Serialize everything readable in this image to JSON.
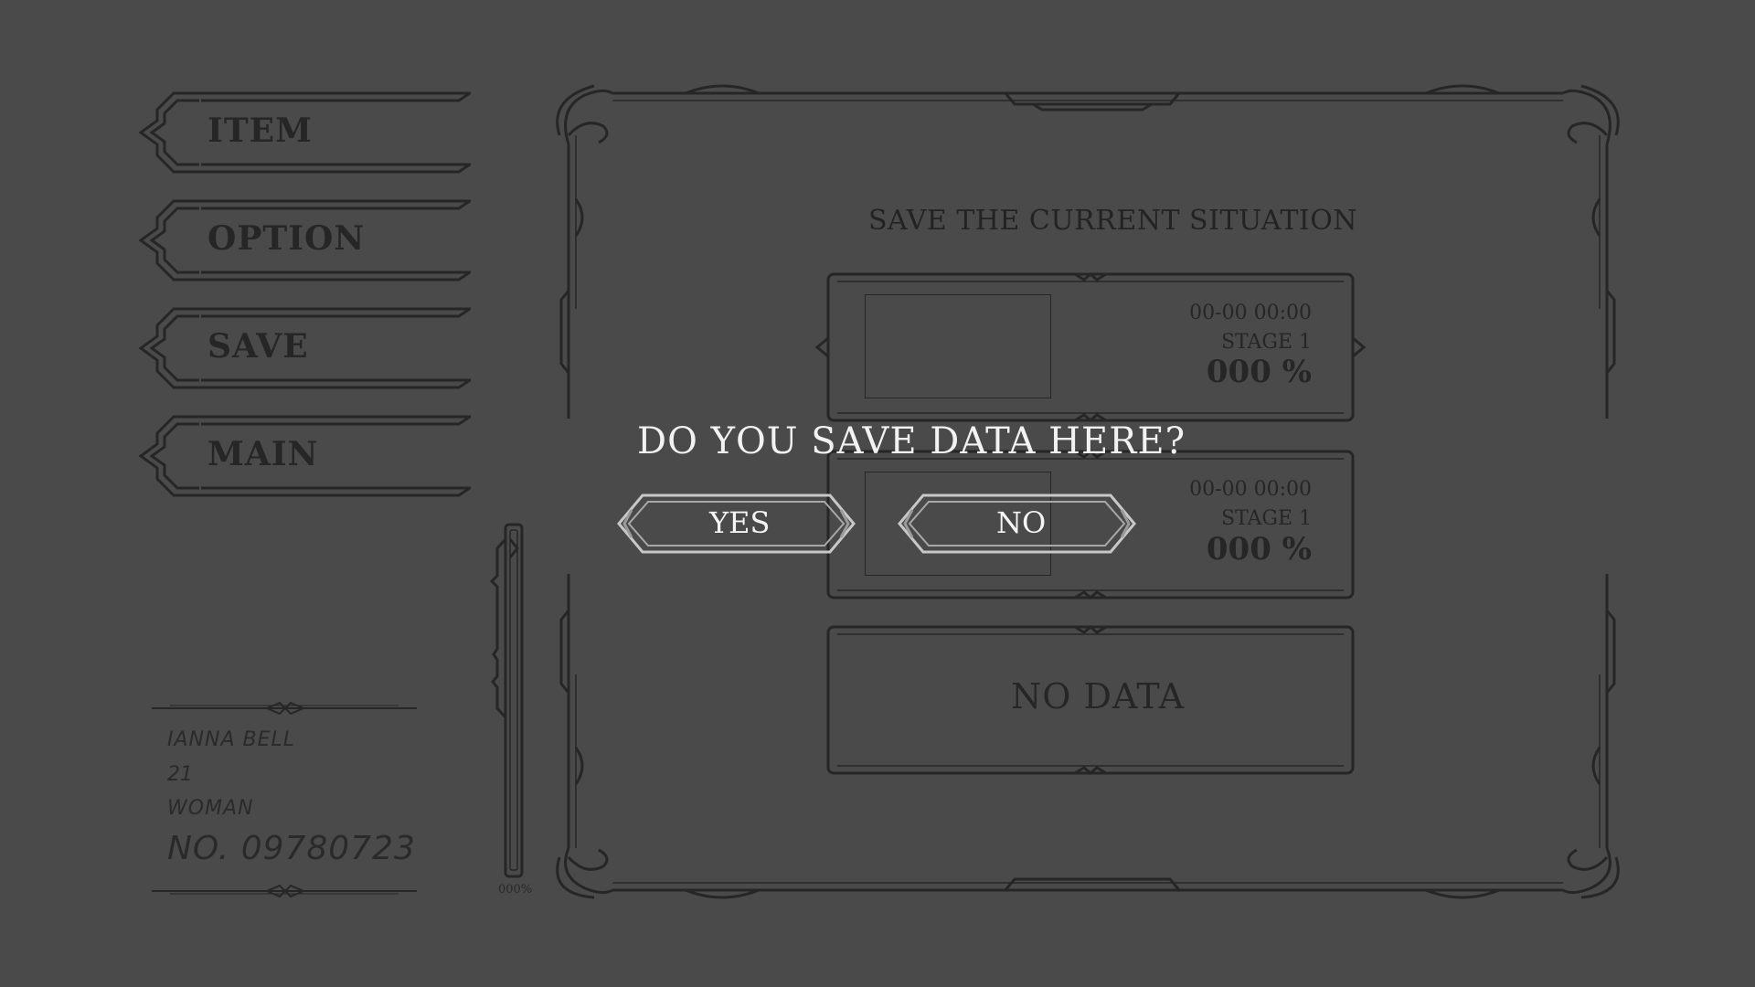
{
  "menu": {
    "items": [
      {
        "label": "ITEM"
      },
      {
        "label": "OPTION"
      },
      {
        "label": "SAVE"
      },
      {
        "label": "MAIN"
      }
    ]
  },
  "character": {
    "name": "IANNA BELL",
    "age": "21",
    "gender": "WOMAN",
    "number": "NO. 09780723"
  },
  "progress": {
    "label": "000%",
    "fill": 0
  },
  "panel": {
    "title": "SAVE THE CURRENT SITUATION",
    "slots": [
      {
        "date": "00-00 00:00",
        "stage": "STAGE 1",
        "percent": "000 %"
      },
      {
        "date": "00-00 00:00",
        "stage": "STAGE 1",
        "percent": "000 %"
      }
    ],
    "empty_slot_label": "NO DATA"
  },
  "dialog": {
    "question": "DO YOU SAVE DATA HERE?",
    "yes_label": "YES",
    "no_label": "NO"
  },
  "colors": {
    "background": "#4a4a4a",
    "frame": "#262626",
    "dialog_text": "#f2f2f2",
    "dialog_button_border": "#c8c8c8"
  }
}
